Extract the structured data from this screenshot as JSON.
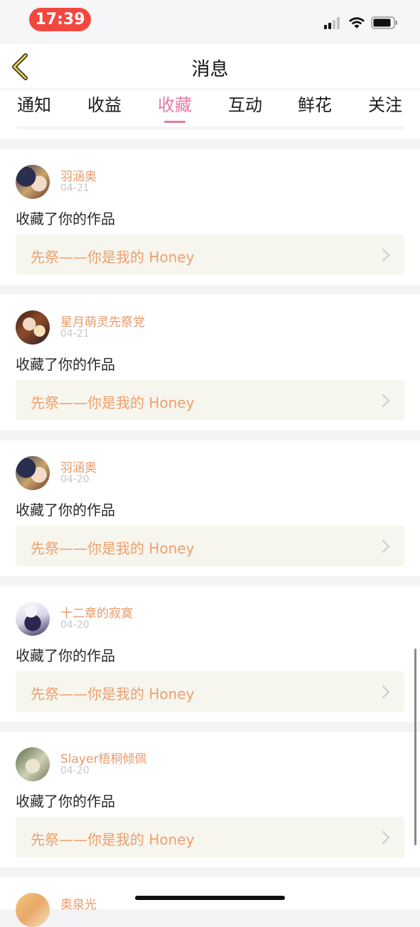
{
  "status_bar": {
    "time": "17:39"
  },
  "nav": {
    "title": "消息"
  },
  "tabs": [
    {
      "label": "通知"
    },
    {
      "label": "收益"
    },
    {
      "label": "收藏"
    },
    {
      "label": "互动"
    },
    {
      "label": "鲜花"
    },
    {
      "label": "关注"
    }
  ],
  "active_tab": "收藏",
  "colors": {
    "accent": "#e879a8",
    "username": "#e89a6a",
    "work_title": "#eea06c",
    "time_pill": "#f2473f"
  },
  "notifications": [
    {
      "user": "羽涵奥",
      "date": "04-21",
      "action": "收藏了你的作品",
      "work": "先祭——你是我的 Honey"
    },
    {
      "user": "星月萌灵先祭党",
      "date": "04-21",
      "action": "收藏了你的作品",
      "work": "先祭——你是我的 Honey"
    },
    {
      "user": "羽涵奥",
      "date": "04-20",
      "action": "收藏了你的作品",
      "work": "先祭——你是我的 Honey"
    },
    {
      "user": "十二章的寂寞",
      "date": "04-20",
      "action": "收藏了你的作品",
      "work": "先祭——你是我的 Honey"
    },
    {
      "user": "Slayer梧桐倾佩",
      "date": "04-20",
      "action": "收藏了你的作品",
      "work": "先祭——你是我的 Honey"
    }
  ],
  "partial_notification": {
    "user": "奥泉光"
  }
}
